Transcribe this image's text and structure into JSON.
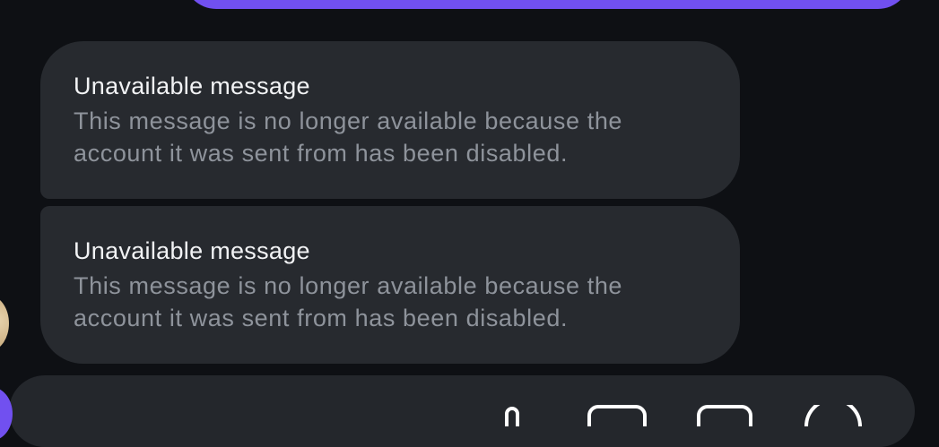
{
  "messages": [
    {
      "title": "Unavailable message",
      "body": "This message is no longer available because the account it was sent from has been disabled."
    },
    {
      "title": "Unavailable message",
      "body": "This message is no longer available because the account it was sent from has been disabled."
    }
  ],
  "composer": {
    "icons": [
      "microphone-icon",
      "gallery-icon",
      "sticker-icon",
      "add-icon"
    ]
  },
  "colors": {
    "background": "#0e1014",
    "bubble": "#272a2f",
    "accent": "#7150f0",
    "title_text": "#f2f3f5",
    "body_text": "#8e939b"
  }
}
